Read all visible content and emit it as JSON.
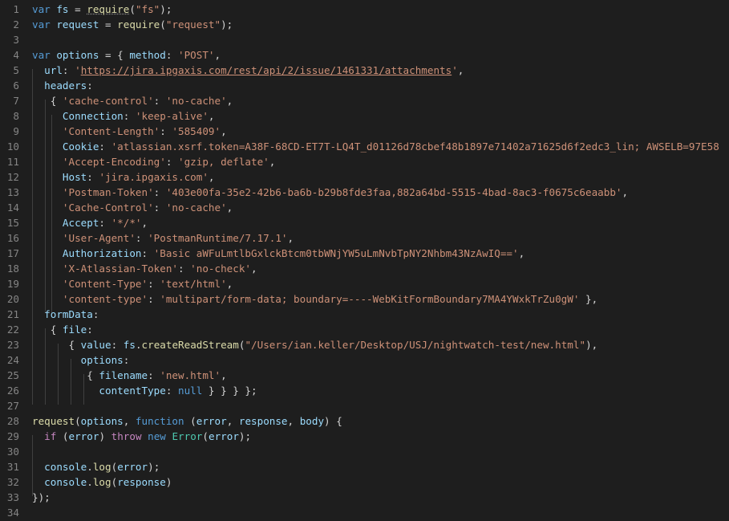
{
  "editor": {
    "theme": {
      "background": "#1e1e1e",
      "line_number": "#858585",
      "keyword": "#569cd6",
      "control": "#c586c0",
      "variable": "#9cdcfe",
      "function": "#dcdcaa",
      "string": "#ce9178",
      "class": "#4ec9b0",
      "plain": "#d4d4d4"
    },
    "lines": [
      {
        "n": "1",
        "tokens": [
          [
            "kw",
            "var"
          ],
          [
            "pl",
            " "
          ],
          [
            "var",
            "fs"
          ],
          [
            "pl",
            " = "
          ],
          [
            "warn",
            "require"
          ],
          [
            "pl",
            "("
          ],
          [
            "str",
            "\"fs\""
          ],
          [
            "pl",
            ");"
          ]
        ]
      },
      {
        "n": "2",
        "tokens": [
          [
            "kw",
            "var"
          ],
          [
            "pl",
            " "
          ],
          [
            "var",
            "request"
          ],
          [
            "pl",
            " = "
          ],
          [
            "fn",
            "require"
          ],
          [
            "pl",
            "("
          ],
          [
            "str",
            "\"request\""
          ],
          [
            "pl",
            ");"
          ]
        ]
      },
      {
        "n": "3",
        "tokens": []
      },
      {
        "n": "4",
        "tokens": [
          [
            "kw",
            "var"
          ],
          [
            "pl",
            " "
          ],
          [
            "var",
            "options"
          ],
          [
            "pl",
            " = { "
          ],
          [
            "var",
            "method"
          ],
          [
            "pl",
            ": "
          ],
          [
            "str",
            "'POST'"
          ],
          [
            "pl",
            ","
          ]
        ]
      },
      {
        "n": "5",
        "tokens": [
          [
            "pl",
            "  "
          ],
          [
            "var",
            "url"
          ],
          [
            "pl",
            ": "
          ],
          [
            "str",
            "'"
          ],
          [
            "url",
            "https://jira.ipgaxis.com/rest/api/2/issue/1461331/attachments"
          ],
          [
            "str",
            "'"
          ],
          [
            "pl",
            ","
          ]
        ]
      },
      {
        "n": "6",
        "tokens": [
          [
            "pl",
            "  "
          ],
          [
            "var",
            "headers"
          ],
          [
            "pl",
            ":"
          ]
        ]
      },
      {
        "n": "7",
        "tokens": [
          [
            "pl",
            "   { "
          ],
          [
            "str",
            "'cache-control'"
          ],
          [
            "pl",
            ": "
          ],
          [
            "str",
            "'no-cache'"
          ],
          [
            "pl",
            ","
          ]
        ]
      },
      {
        "n": "8",
        "tokens": [
          [
            "pl",
            "     "
          ],
          [
            "var",
            "Connection"
          ],
          [
            "pl",
            ": "
          ],
          [
            "str",
            "'keep-alive'"
          ],
          [
            "pl",
            ","
          ]
        ]
      },
      {
        "n": "9",
        "tokens": [
          [
            "pl",
            "     "
          ],
          [
            "str",
            "'Content-Length'"
          ],
          [
            "pl",
            ": "
          ],
          [
            "str",
            "'585409'"
          ],
          [
            "pl",
            ","
          ]
        ]
      },
      {
        "n": "10",
        "tokens": [
          [
            "pl",
            "     "
          ],
          [
            "var",
            "Cookie"
          ],
          [
            "pl",
            ": "
          ],
          [
            "str",
            "'atlassian.xsrf.token=A38F-68CD-ET7T-LQ4T_d01126d78cbef48b1897e71402a71625d6f2edc3_lin; AWSELB=97E58"
          ]
        ]
      },
      {
        "n": "11",
        "tokens": [
          [
            "pl",
            "     "
          ],
          [
            "str",
            "'Accept-Encoding'"
          ],
          [
            "pl",
            ": "
          ],
          [
            "str",
            "'gzip, deflate'"
          ],
          [
            "pl",
            ","
          ]
        ]
      },
      {
        "n": "12",
        "tokens": [
          [
            "pl",
            "     "
          ],
          [
            "var",
            "Host"
          ],
          [
            "pl",
            ": "
          ],
          [
            "str",
            "'jira.ipgaxis.com'"
          ],
          [
            "pl",
            ","
          ]
        ]
      },
      {
        "n": "13",
        "tokens": [
          [
            "pl",
            "     "
          ],
          [
            "str",
            "'Postman-Token'"
          ],
          [
            "pl",
            ": "
          ],
          [
            "str",
            "'403e00fa-35e2-42b6-ba6b-b29b8fde3faa,882a64bd-5515-4bad-8ac3-f0675c6eaabb'"
          ],
          [
            "pl",
            ","
          ]
        ]
      },
      {
        "n": "14",
        "tokens": [
          [
            "pl",
            "     "
          ],
          [
            "str",
            "'Cache-Control'"
          ],
          [
            "pl",
            ": "
          ],
          [
            "str",
            "'no-cache'"
          ],
          [
            "pl",
            ","
          ]
        ]
      },
      {
        "n": "15",
        "tokens": [
          [
            "pl",
            "     "
          ],
          [
            "var",
            "Accept"
          ],
          [
            "pl",
            ": "
          ],
          [
            "str",
            "'*/*'"
          ],
          [
            "pl",
            ","
          ]
        ]
      },
      {
        "n": "16",
        "tokens": [
          [
            "pl",
            "     "
          ],
          [
            "str",
            "'User-Agent'"
          ],
          [
            "pl",
            ": "
          ],
          [
            "str",
            "'PostmanRuntime/7.17.1'"
          ],
          [
            "pl",
            ","
          ]
        ]
      },
      {
        "n": "17",
        "tokens": [
          [
            "pl",
            "     "
          ],
          [
            "var",
            "Authorization"
          ],
          [
            "pl",
            ": "
          ],
          [
            "str",
            "'Basic aWFuLmtlbGxlckBtcm0tbWNjYW5uLmNvbTpNY2Nhbm43NzAwIQ=='"
          ],
          [
            "pl",
            ","
          ]
        ]
      },
      {
        "n": "18",
        "tokens": [
          [
            "pl",
            "     "
          ],
          [
            "str",
            "'X-Atlassian-Token'"
          ],
          [
            "pl",
            ": "
          ],
          [
            "str",
            "'no-check'"
          ],
          [
            "pl",
            ","
          ]
        ]
      },
      {
        "n": "19",
        "tokens": [
          [
            "pl",
            "     "
          ],
          [
            "str",
            "'Content-Type'"
          ],
          [
            "pl",
            ": "
          ],
          [
            "str",
            "'text/html'"
          ],
          [
            "pl",
            ","
          ]
        ]
      },
      {
        "n": "20",
        "tokens": [
          [
            "pl",
            "     "
          ],
          [
            "str",
            "'content-type'"
          ],
          [
            "pl",
            ": "
          ],
          [
            "str",
            "'multipart/form-data; boundary=----WebKitFormBoundary7MA4YWxkTrZu0gW'"
          ],
          [
            "pl",
            " },"
          ]
        ]
      },
      {
        "n": "21",
        "tokens": [
          [
            "pl",
            "  "
          ],
          [
            "var",
            "formData"
          ],
          [
            "pl",
            ":"
          ]
        ]
      },
      {
        "n": "22",
        "tokens": [
          [
            "pl",
            "   { "
          ],
          [
            "var",
            "file"
          ],
          [
            "pl",
            ":"
          ]
        ]
      },
      {
        "n": "23",
        "tokens": [
          [
            "pl",
            "      { "
          ],
          [
            "var",
            "value"
          ],
          [
            "pl",
            ": "
          ],
          [
            "var",
            "fs"
          ],
          [
            "pl",
            "."
          ],
          [
            "fn",
            "createReadStream"
          ],
          [
            "pl",
            "("
          ],
          [
            "str",
            "\"/Users/ian.keller/Desktop/USJ/nightwatch-test/new.html\""
          ],
          [
            "pl",
            "),"
          ]
        ]
      },
      {
        "n": "24",
        "tokens": [
          [
            "pl",
            "        "
          ],
          [
            "var",
            "options"
          ],
          [
            "pl",
            ":"
          ]
        ]
      },
      {
        "n": "25",
        "tokens": [
          [
            "pl",
            "         { "
          ],
          [
            "var",
            "filename"
          ],
          [
            "pl",
            ": "
          ],
          [
            "str",
            "'new.html'"
          ],
          [
            "pl",
            ","
          ]
        ]
      },
      {
        "n": "26",
        "tokens": [
          [
            "pl",
            "           "
          ],
          [
            "var",
            "contentType"
          ],
          [
            "pl",
            ": "
          ],
          [
            "kw",
            "null"
          ],
          [
            "pl",
            " } } } };"
          ]
        ]
      },
      {
        "n": "27",
        "tokens": []
      },
      {
        "n": "28",
        "tokens": [
          [
            "fn",
            "request"
          ],
          [
            "pl",
            "("
          ],
          [
            "var",
            "options"
          ],
          [
            "pl",
            ", "
          ],
          [
            "kw",
            "function"
          ],
          [
            "pl",
            " ("
          ],
          [
            "var",
            "error"
          ],
          [
            "pl",
            ", "
          ],
          [
            "var",
            "response"
          ],
          [
            "pl",
            ", "
          ],
          [
            "var",
            "body"
          ],
          [
            "pl",
            ") {"
          ]
        ]
      },
      {
        "n": "29",
        "tokens": [
          [
            "pl",
            "  "
          ],
          [
            "ctl",
            "if"
          ],
          [
            "pl",
            " ("
          ],
          [
            "var",
            "error"
          ],
          [
            "pl",
            ") "
          ],
          [
            "ctl",
            "throw"
          ],
          [
            "pl",
            " "
          ],
          [
            "kw",
            "new"
          ],
          [
            "pl",
            " "
          ],
          [
            "cls",
            "Error"
          ],
          [
            "pl",
            "("
          ],
          [
            "var",
            "error"
          ],
          [
            "pl",
            ");"
          ]
        ]
      },
      {
        "n": "30",
        "tokens": []
      },
      {
        "n": "31",
        "tokens": [
          [
            "pl",
            "  "
          ],
          [
            "var",
            "console"
          ],
          [
            "pl",
            "."
          ],
          [
            "fn",
            "log"
          ],
          [
            "pl",
            "("
          ],
          [
            "var",
            "error"
          ],
          [
            "pl",
            ");"
          ]
        ]
      },
      {
        "n": "32",
        "tokens": [
          [
            "pl",
            "  "
          ],
          [
            "var",
            "console"
          ],
          [
            "pl",
            "."
          ],
          [
            "fn",
            "log"
          ],
          [
            "pl",
            "("
          ],
          [
            "var",
            "response"
          ],
          [
            "pl",
            ")"
          ]
        ]
      },
      {
        "n": "33",
        "tokens": [
          [
            "pl",
            "});"
          ]
        ]
      },
      {
        "n": "34",
        "tokens": []
      }
    ]
  }
}
